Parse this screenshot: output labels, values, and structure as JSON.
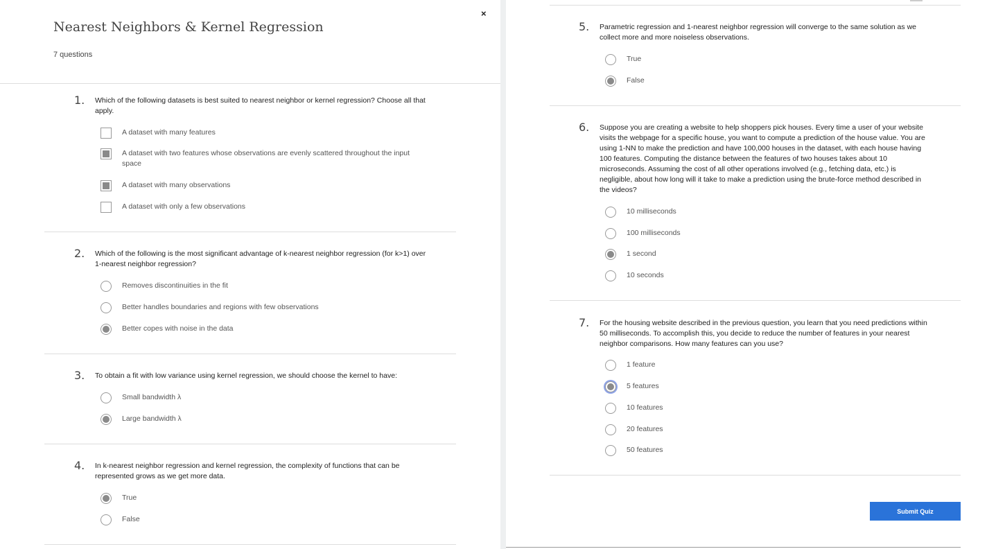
{
  "header": {
    "title": "Nearest Neighbors & Kernel Regression",
    "count": "7 questions",
    "close_glyph": "×"
  },
  "questions": [
    {
      "num": "1.",
      "text": "Which of the following datasets is best suited to nearest neighbor or kernel regression? Choose all that apply.",
      "type": "checkbox",
      "options": [
        {
          "label": "A dataset with many features",
          "selected": false
        },
        {
          "label": "A dataset with two features whose observations are evenly scattered throughout the input space",
          "selected": true
        },
        {
          "label": "A dataset with many observations",
          "selected": true
        },
        {
          "label": "A dataset with only a few observations",
          "selected": false
        }
      ]
    },
    {
      "num": "2.",
      "text": "Which of the following is the most significant advantage of k-nearest neighbor regression (for k>1) over 1-nearest neighbor regression?",
      "type": "radio",
      "options": [
        {
          "label": "Removes discontinuities in the fit",
          "selected": false
        },
        {
          "label": "Better handles boundaries and regions with few observations",
          "selected": false
        },
        {
          "label": "Better copes with noise in the data",
          "selected": true
        }
      ]
    },
    {
      "num": "3.",
      "text": "To obtain a fit with low variance using kernel regression, we should choose the kernel to have:",
      "type": "radio",
      "options": [
        {
          "label": "Small bandwidth λ",
          "selected": false
        },
        {
          "label": "Large bandwidth λ",
          "selected": true
        }
      ]
    },
    {
      "num": "4.",
      "text": "In k-nearest neighbor regression and kernel regression, the complexity of functions that can be represented grows as we get more data.",
      "type": "radio",
      "options": [
        {
          "label": "True",
          "selected": true
        },
        {
          "label": "False",
          "selected": false
        }
      ]
    },
    {
      "num": "5.",
      "text": "Parametric regression and 1-nearest neighbor regression will converge to the same solution as we collect more and more noiseless observations.",
      "type": "radio",
      "options": [
        {
          "label": "True",
          "selected": false
        },
        {
          "label": "False",
          "selected": true
        }
      ]
    },
    {
      "num": "6.",
      "text": "Suppose you are creating a website to help shoppers pick houses. Every time a user of your website visits the webpage for a specific house, you want to compute a prediction of the house value. You are using 1-NN to make the prediction and have 100,000 houses in the dataset, with each house having 100 features. Computing the distance between the features of two houses takes about 10 microseconds. Assuming the cost of all other operations involved (e.g., fetching data, etc.) is negligible, about how long will it take to make a prediction using the brute-force method described in the videos?",
      "type": "radio",
      "options": [
        {
          "label": "10 milliseconds",
          "selected": false
        },
        {
          "label": "100 milliseconds",
          "selected": false
        },
        {
          "label": "1 second",
          "selected": true
        },
        {
          "label": "10 seconds",
          "selected": false
        }
      ]
    },
    {
      "num": "7.",
      "text": "For the housing website described in the previous question, you learn that you need predictions within 50 milliseconds. To accomplish this, you decide to reduce the number of features in your nearest neighbor comparisons. How many features can you use?",
      "type": "radio",
      "options": [
        {
          "label": "1 feature",
          "selected": false
        },
        {
          "label": "5 features",
          "selected": true,
          "focused": true
        },
        {
          "label": "10 features",
          "selected": false
        },
        {
          "label": "20 features",
          "selected": false
        },
        {
          "label": "50 features",
          "selected": false
        }
      ]
    }
  ],
  "submit_label": "Submit Quiz",
  "colors": {
    "accent": "#2a73d9",
    "selected": "#8a8a8a",
    "focus": "#8ea3e8"
  }
}
